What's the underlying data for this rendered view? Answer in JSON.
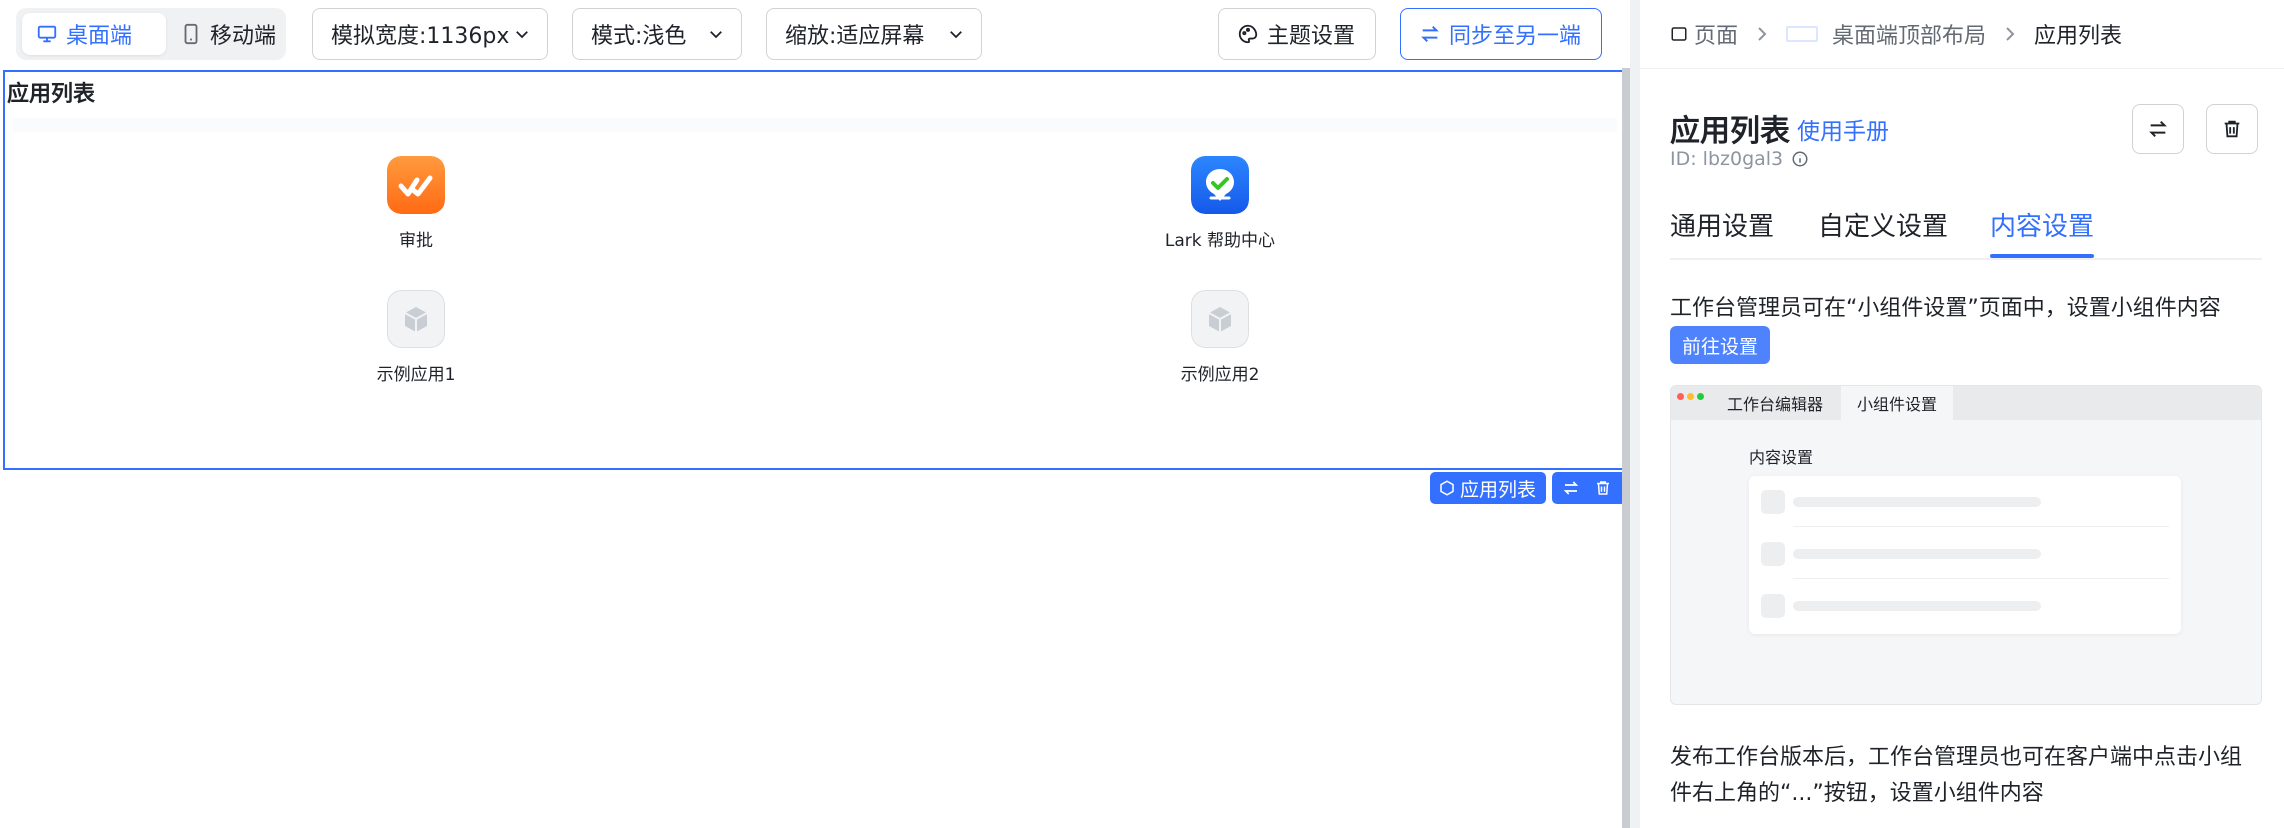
{
  "toolbar": {
    "device_desktop": "桌面端",
    "device_mobile": "移动端",
    "width_select": "模拟宽度:1136px",
    "mode_select": "模式:浅色",
    "zoom_select": "缩放:适应屏幕",
    "theme_button": "主题设置",
    "sync_button": "同步至另一端"
  },
  "widget": {
    "title": "应用列表",
    "apps": [
      {
        "name": "审批",
        "icon": "approval-icon"
      },
      {
        "name": "Lark 帮助中心",
        "icon": "help-center-icon"
      },
      {
        "name": "示例应用1",
        "icon": "cube-icon"
      },
      {
        "name": "示例应用2",
        "icon": "cube-icon"
      }
    ],
    "tag_label": "应用列表"
  },
  "panel": {
    "breadcrumb": [
      "页面",
      "桌面端顶部布局",
      "应用列表"
    ],
    "title": "应用列表",
    "manual_link": "使用手册",
    "id_text": "ID: lbz0gal3",
    "tabs": [
      "通用设置",
      "自定义设置",
      "内容设置"
    ],
    "active_tab": 2,
    "desc1": "工作台管理员可在“小组件设置”页面中，设置小组件内容",
    "goto_button": "前往设置",
    "preview": {
      "tab1": "工作台编辑器",
      "tab2": "小组件设置",
      "section_label": "内容设置"
    },
    "desc2": "发布工作台版本后，工作台管理员也可在客户端中点击小组件右上角的“...”按钮，设置小组件内容"
  },
  "colors": {
    "accent": "#3370ff",
    "approval_icon": "#ff7d1f",
    "help_icon": "#1e6bff"
  }
}
